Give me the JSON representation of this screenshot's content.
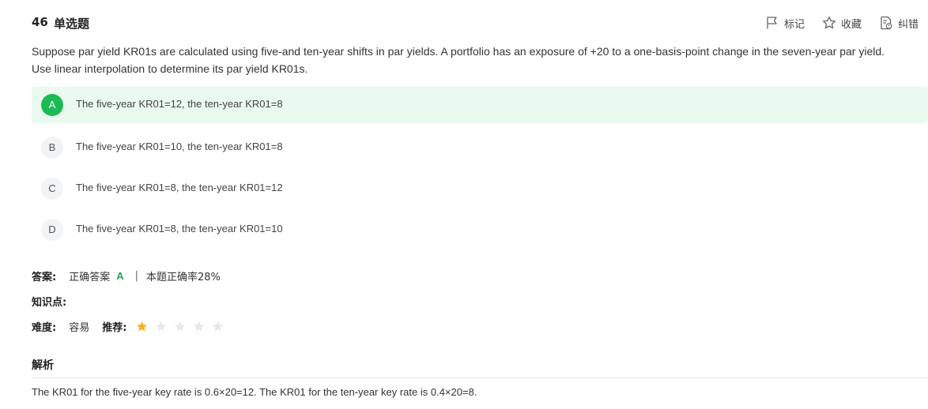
{
  "question": {
    "number": "46",
    "type": "单选题",
    "stem_line1": "Suppose par yield KR01s are calculated using five-and ten-year shifts in par yields. A portfolio has an exposure of +20 to a one-basis-point change in the seven-year par yield.",
    "stem_line2": "Use linear interpolation to determine its par yield KR01s."
  },
  "actions": {
    "mark_label": "标记",
    "favorite_label": "收藏",
    "report_label": "纠错",
    "mark_icon": "flag-icon",
    "favorite_icon": "star-outline-icon",
    "report_icon": "report-error-icon"
  },
  "options": [
    {
      "letter": "A",
      "text": "The five-year KR01=12, the ten-year KR01=8",
      "correct": true
    },
    {
      "letter": "B",
      "text": "The five-year KR01=10, the ten-year KR01=8",
      "correct": false
    },
    {
      "letter": "C",
      "text": "The five-year KR01=8, the ten-year KR01=12",
      "correct": false
    },
    {
      "letter": "D",
      "text": "The five-year KR01=8, the ten-year KR01=10",
      "correct": false
    }
  ],
  "answer": {
    "label": "答案:",
    "text": "正确答案",
    "letter": "A",
    "separator": "|",
    "rate_text": "本题正确率28%"
  },
  "knowledge": {
    "label": "知识点:"
  },
  "difficulty": {
    "label": "难度:",
    "value": "容易",
    "recommend_label": "推荐:",
    "rating": 1,
    "max_rating": 5
  },
  "analysis": {
    "title": "解析",
    "text": "The KR01 for the five-year key rate is 0.6×20=12. The KR01 for the ten-year key rate is 0.4×20=8."
  },
  "colors": {
    "correct_green": "#1db954",
    "correct_bg": "#e9f9ee",
    "star_on": "#f5b21c",
    "star_off": "#e8e8e8"
  }
}
